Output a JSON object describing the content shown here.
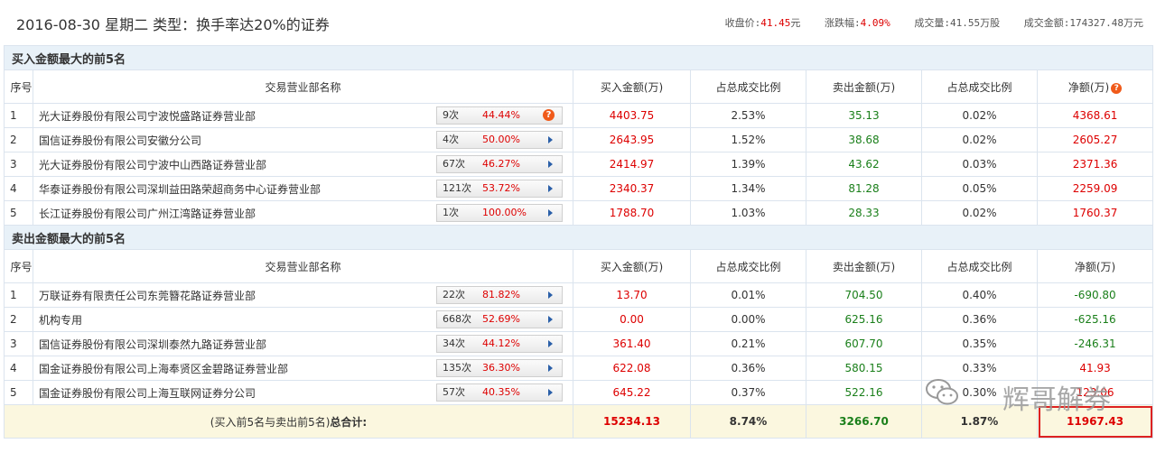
{
  "header": {
    "title": "2016-08-30 星期二  类型：换手率达20%的证券",
    "stats": [
      {
        "label": "收盘价:",
        "value": "41.45",
        "unit": "元",
        "up": true
      },
      {
        "label": "涨跌幅:",
        "value": "4.09%",
        "unit": "",
        "up": true
      },
      {
        "label": "成交量:",
        "value": "41.55万股",
        "unit": "",
        "up": false
      },
      {
        "label": "成交金额:",
        "value": "174327.48万元",
        "unit": "",
        "up": false
      }
    ]
  },
  "columns": [
    "序号",
    "交易营业部名称",
    "买入金额(万)",
    "占总成交比例",
    "卖出金额(万)",
    "占总成交比例",
    "净额(万)"
  ],
  "buy_section": {
    "title": "买入金额最大的前5名",
    "rows": [
      {
        "idx": "1",
        "name": "光大证券股份有限公司宁波悦盛路证券营业部",
        "count": "9次",
        "pct": "44.44%",
        "buy": "4403.75",
        "buy_ratio": "2.53%",
        "sell": "35.13",
        "sell_ratio": "0.02%",
        "net": "4368.61",
        "mark": "question"
      },
      {
        "idx": "2",
        "name": "国信证券股份有限公司安徽分公司",
        "count": "4次",
        "pct": "50.00%",
        "buy": "2643.95",
        "buy_ratio": "1.52%",
        "sell": "38.68",
        "sell_ratio": "0.02%",
        "net": "2605.27",
        "mark": "arrow"
      },
      {
        "idx": "3",
        "name": "光大证券股份有限公司宁波中山西路证券营业部",
        "count": "67次",
        "pct": "46.27%",
        "buy": "2414.97",
        "buy_ratio": "1.39%",
        "sell": "43.62",
        "sell_ratio": "0.03%",
        "net": "2371.36",
        "mark": "arrow"
      },
      {
        "idx": "4",
        "name": "华泰证券股份有限公司深圳益田路荣超商务中心证券营业部",
        "count": "121次",
        "pct": "53.72%",
        "buy": "2340.37",
        "buy_ratio": "1.34%",
        "sell": "81.28",
        "sell_ratio": "0.05%",
        "net": "2259.09",
        "mark": "arrow"
      },
      {
        "idx": "5",
        "name": "长江证券股份有限公司广州江湾路证券营业部",
        "count": "1次",
        "pct": "100.00%",
        "buy": "1788.70",
        "buy_ratio": "1.03%",
        "sell": "28.33",
        "sell_ratio": "0.02%",
        "net": "1760.37",
        "mark": "arrow"
      }
    ]
  },
  "sell_section": {
    "title": "卖出金额最大的前5名",
    "rows": [
      {
        "idx": "1",
        "name": "万联证券有限责任公司东莞簪花路证券营业部",
        "count": "22次",
        "pct": "81.82%",
        "buy": "13.70",
        "buy_ratio": "0.01%",
        "sell": "704.50",
        "sell_ratio": "0.40%",
        "net": "-690.80",
        "mark": "arrow"
      },
      {
        "idx": "2",
        "name": "机构专用",
        "count": "668次",
        "pct": "52.69%",
        "buy": "0.00",
        "buy_ratio": "0.00%",
        "sell": "625.16",
        "sell_ratio": "0.36%",
        "net": "-625.16",
        "mark": "arrow"
      },
      {
        "idx": "3",
        "name": "国信证券股份有限公司深圳泰然九路证券营业部",
        "count": "34次",
        "pct": "44.12%",
        "buy": "361.40",
        "buy_ratio": "0.21%",
        "sell": "607.70",
        "sell_ratio": "0.35%",
        "net": "-246.31",
        "mark": "arrow"
      },
      {
        "idx": "4",
        "name": "国金证券股份有限公司上海奉贤区金碧路证券营业部",
        "count": "135次",
        "pct": "36.30%",
        "buy": "622.08",
        "buy_ratio": "0.36%",
        "sell": "580.15",
        "sell_ratio": "0.33%",
        "net": "41.93",
        "mark": "arrow"
      },
      {
        "idx": "5",
        "name": "国金证券股份有限公司上海互联网证券分公司",
        "count": "57次",
        "pct": "40.35%",
        "buy": "645.22",
        "buy_ratio": "0.37%",
        "sell": "522.16",
        "sell_ratio": "0.30%",
        "net": "123.06",
        "mark": "arrow"
      }
    ]
  },
  "total": {
    "label": "(买入前5名与卖出前5名)",
    "label_bold": "总合计:",
    "buy": "15234.13",
    "buy_ratio": "8.74%",
    "sell": "3266.70",
    "sell_ratio": "1.87%",
    "net": "11967.43"
  },
  "watermark": {
    "text": "辉哥解券",
    "icon": "wechat-icon"
  },
  "colors": {
    "up": "#dd0000",
    "down": "#1a7f1a",
    "section_bg": "#e8f1f8",
    "total_bg": "#fbf7df",
    "highlight": "#dd2222"
  }
}
